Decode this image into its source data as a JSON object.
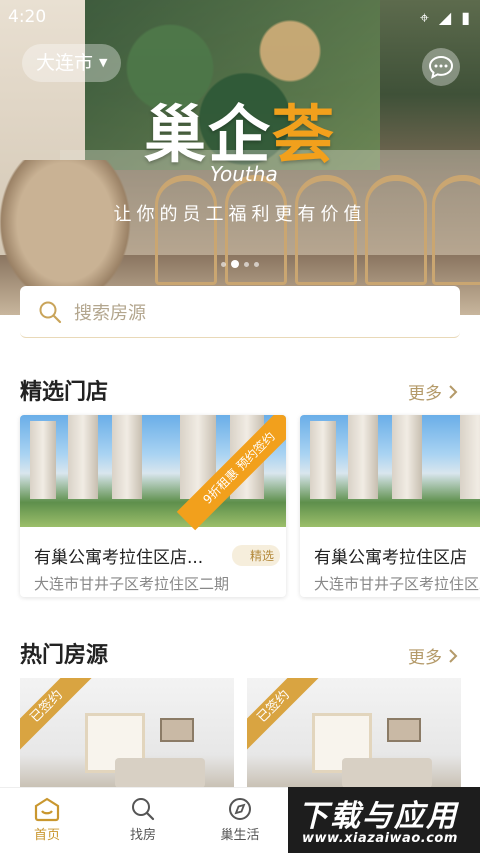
{
  "status_bar": {
    "time": "4:20"
  },
  "header": {
    "city": "大连市"
  },
  "banner": {
    "logo_main": "巢企",
    "logo_accent": "荟",
    "logo_sub": "Youtha",
    "slogan": "让你的员工福利更有价值"
  },
  "search": {
    "placeholder": "搜索房源"
  },
  "featured": {
    "title": "精选门店",
    "more": "更多",
    "stores": [
      {
        "name": "有巢公寓考拉住区店...",
        "address": "大连市甘井子区考拉住区二期",
        "tag": "精选",
        "promo": "9折租惠 预约签约"
      },
      {
        "name": "有巢公寓考拉住区店",
        "address": "大连市甘井子区考拉住区二期"
      }
    ]
  },
  "hot": {
    "title": "热门房源",
    "more": "更多",
    "rooms": [
      {
        "badge": "已签约"
      },
      {
        "badge": "已签约"
      }
    ]
  },
  "tabbar": {
    "items": [
      {
        "label": "首页"
      },
      {
        "label": "找房"
      },
      {
        "label": "巢生活"
      }
    ]
  },
  "watermark": {
    "text": "下载与应用",
    "url": "www.xiazaiwao.com"
  },
  "colors": {
    "accent": "#c9972f",
    "brand_orange": "#f2a01c"
  }
}
